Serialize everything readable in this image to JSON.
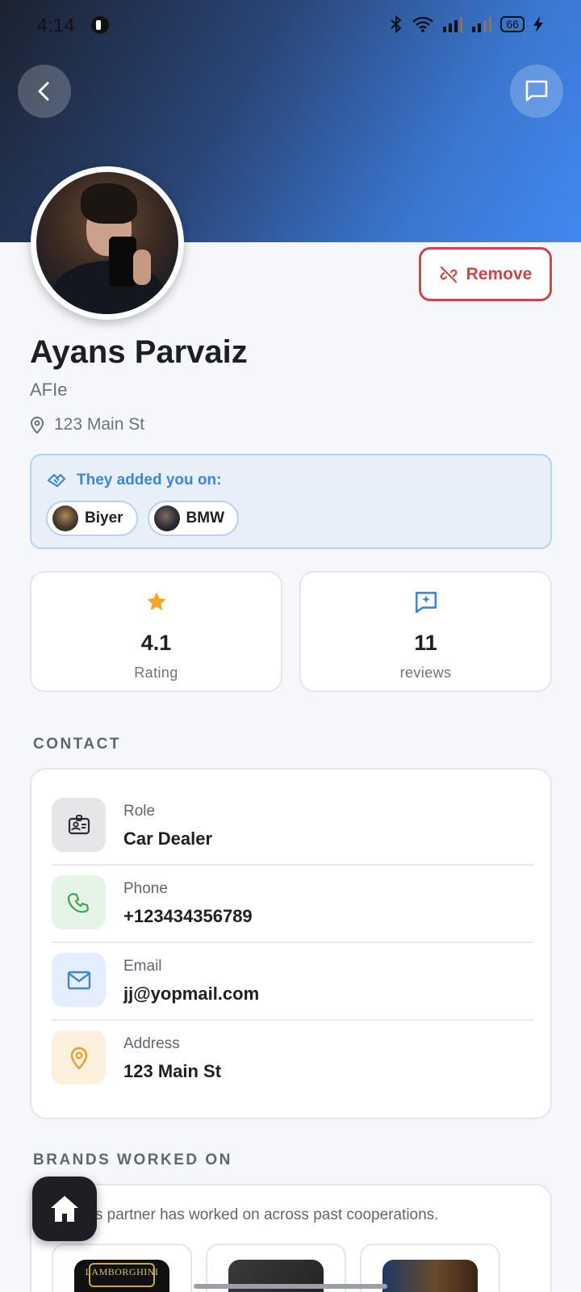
{
  "status_bar": {
    "time": "4:14",
    "battery": "66"
  },
  "profile": {
    "name": "Ayans Parvaiz",
    "subtitle": "AFIe",
    "location": "123 Main St",
    "remove_label": "Remove"
  },
  "added_on": {
    "heading": "They added you on:",
    "chips": [
      {
        "label": "Biyer"
      },
      {
        "label": "BMW"
      }
    ]
  },
  "stats": [
    {
      "value": "4.1",
      "label": "Rating",
      "icon": "star-icon"
    },
    {
      "value": "11",
      "label": "reviews",
      "icon": "review-icon"
    }
  ],
  "contact": {
    "title": "CONTACT",
    "rows": [
      {
        "label": "Role",
        "value": "Car Dealer",
        "icon": "id-badge-icon",
        "color": "#e5e6e8"
      },
      {
        "label": "Phone",
        "value": "+123434356789",
        "icon": "phone-icon",
        "color": "#e6f4e8"
      },
      {
        "label": "Email",
        "value": "jj@yopmail.com",
        "icon": "mail-icon",
        "color": "#e4eefc"
      },
      {
        "label": "Address",
        "value": "123 Main St",
        "icon": "pin-icon",
        "color": "#fdf0dd"
      }
    ]
  },
  "brands": {
    "title": "BRANDS WORKED ON",
    "description": "s this partner has worked on across past cooperations.",
    "items": [
      {
        "logo_text": "LAMBORGHINI"
      },
      {
        "logo_text": ""
      },
      {
        "logo_text": ""
      }
    ]
  },
  "colors": {
    "accent": "#3c86d6",
    "danger": "#c9474b",
    "star": "#f5a623"
  }
}
